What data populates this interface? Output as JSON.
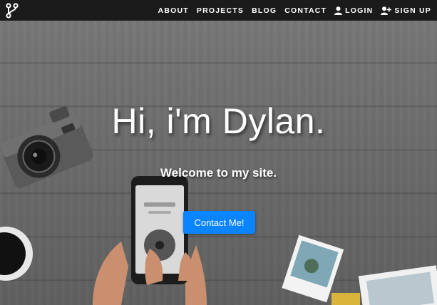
{
  "nav": {
    "brand_icon": "fork-logo-icon",
    "links": [
      {
        "label": "ABOUT"
      },
      {
        "label": "PROJECTS"
      },
      {
        "label": "BLOG"
      },
      {
        "label": "CONTACT"
      },
      {
        "label": "LOGIN",
        "icon": "user-icon"
      },
      {
        "label": "SIGN UP",
        "icon": "user-plus-icon"
      }
    ]
  },
  "hero": {
    "title": "Hi, i'm Dylan.",
    "subtitle": "Welcome to my site.",
    "cta_label": "Contact Me!",
    "cta_color": "#0a84ff"
  },
  "theme": {
    "navbar_bg": "#1b1b1b",
    "text_color": "#ffffff"
  }
}
